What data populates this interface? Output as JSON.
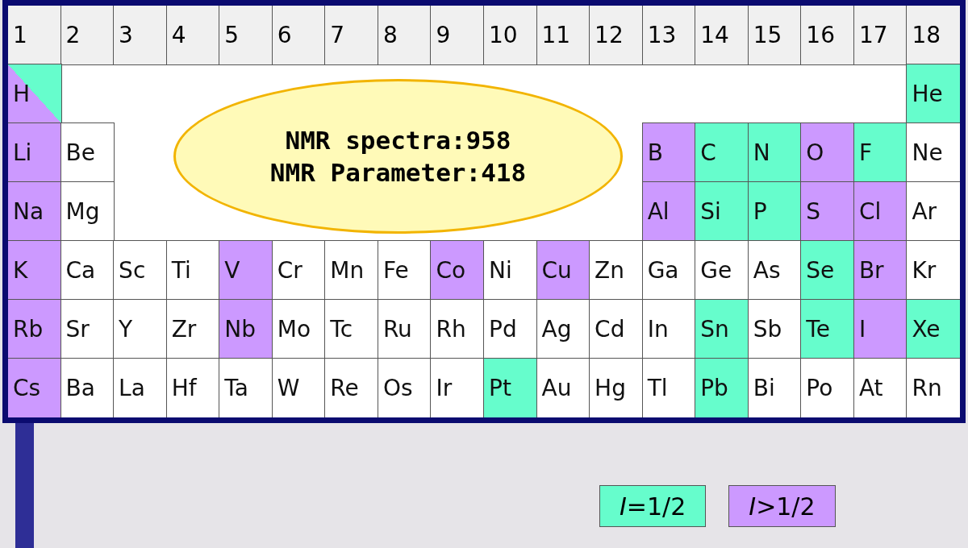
{
  "groups": [
    "1",
    "2",
    "3",
    "4",
    "5",
    "6",
    "7",
    "8",
    "9",
    "10",
    "11",
    "12",
    "13",
    "14",
    "15",
    "16",
    "17",
    "18"
  ],
  "periods": [
    {
      "left": [
        {
          "symbol": "H",
          "kind": "both"
        }
      ],
      "right": [
        {
          "symbol": "He",
          "kind": "half"
        }
      ]
    },
    {
      "left": [
        {
          "symbol": "Li",
          "kind": "gt"
        },
        {
          "symbol": "Be",
          "kind": "none"
        }
      ],
      "right": [
        {
          "symbol": "B",
          "kind": "gt"
        },
        {
          "symbol": "C",
          "kind": "half"
        },
        {
          "symbol": "N",
          "kind": "half"
        },
        {
          "symbol": "O",
          "kind": "gt"
        },
        {
          "symbol": "F",
          "kind": "half"
        },
        {
          "symbol": "Ne",
          "kind": "none"
        }
      ]
    },
    {
      "left": [
        {
          "symbol": "Na",
          "kind": "gt"
        },
        {
          "symbol": "Mg",
          "kind": "none"
        }
      ],
      "right": [
        {
          "symbol": "Al",
          "kind": "gt"
        },
        {
          "symbol": "Si",
          "kind": "half"
        },
        {
          "symbol": "P",
          "kind": "half"
        },
        {
          "symbol": "S",
          "kind": "gt"
        },
        {
          "symbol": "Cl",
          "kind": "gt"
        },
        {
          "symbol": "Ar",
          "kind": "none"
        }
      ]
    },
    {
      "left": [
        {
          "symbol": "K",
          "kind": "gt"
        },
        {
          "symbol": "Ca",
          "kind": "none"
        },
        {
          "symbol": "Sc",
          "kind": "none"
        },
        {
          "symbol": "Ti",
          "kind": "none"
        },
        {
          "symbol": "V",
          "kind": "gt"
        },
        {
          "symbol": "Cr",
          "kind": "none"
        },
        {
          "symbol": "Mn",
          "kind": "none"
        },
        {
          "symbol": "Fe",
          "kind": "none"
        },
        {
          "symbol": "Co",
          "kind": "gt"
        },
        {
          "symbol": "Ni",
          "kind": "none"
        },
        {
          "symbol": "Cu",
          "kind": "gt"
        },
        {
          "symbol": "Zn",
          "kind": "none"
        },
        {
          "symbol": "Ga",
          "kind": "none"
        },
        {
          "symbol": "Ge",
          "kind": "none"
        },
        {
          "symbol": "As",
          "kind": "none"
        },
        {
          "symbol": "Se",
          "kind": "half"
        },
        {
          "symbol": "Br",
          "kind": "gt"
        },
        {
          "symbol": "Kr",
          "kind": "none"
        }
      ]
    },
    {
      "left": [
        {
          "symbol": "Rb",
          "kind": "gt"
        },
        {
          "symbol": "Sr",
          "kind": "none"
        },
        {
          "symbol": "Y",
          "kind": "none"
        },
        {
          "symbol": "Zr",
          "kind": "none"
        },
        {
          "symbol": "Nb",
          "kind": "gt"
        },
        {
          "symbol": "Mo",
          "kind": "none"
        },
        {
          "symbol": "Tc",
          "kind": "none"
        },
        {
          "symbol": "Ru",
          "kind": "none"
        },
        {
          "symbol": "Rh",
          "kind": "none"
        },
        {
          "symbol": "Pd",
          "kind": "none"
        },
        {
          "symbol": "Ag",
          "kind": "none"
        },
        {
          "symbol": "Cd",
          "kind": "none"
        },
        {
          "symbol": "In",
          "kind": "none"
        },
        {
          "symbol": "Sn",
          "kind": "half"
        },
        {
          "symbol": "Sb",
          "kind": "none"
        },
        {
          "symbol": "Te",
          "kind": "half"
        },
        {
          "symbol": "I",
          "kind": "gt"
        },
        {
          "symbol": "Xe",
          "kind": "half"
        }
      ]
    },
    {
      "left": [
        {
          "symbol": "Cs",
          "kind": "gt"
        },
        {
          "symbol": "Ba",
          "kind": "none"
        },
        {
          "symbol": "La",
          "kind": "none"
        },
        {
          "symbol": "Hf",
          "kind": "none"
        },
        {
          "symbol": "Ta",
          "kind": "none"
        },
        {
          "symbol": "W",
          "kind": "none"
        },
        {
          "symbol": "Re",
          "kind": "none"
        },
        {
          "symbol": "Os",
          "kind": "none"
        },
        {
          "symbol": "Ir",
          "kind": "none"
        },
        {
          "symbol": "Pt",
          "kind": "half"
        },
        {
          "symbol": "Au",
          "kind": "none"
        },
        {
          "symbol": "Hg",
          "kind": "none"
        },
        {
          "symbol": "Tl",
          "kind": "none"
        },
        {
          "symbol": "Pb",
          "kind": "half"
        },
        {
          "symbol": "Bi",
          "kind": "none"
        },
        {
          "symbol": "Po",
          "kind": "none"
        },
        {
          "symbol": "At",
          "kind": "none"
        },
        {
          "symbol": "Rn",
          "kind": "none"
        }
      ]
    }
  ],
  "summary": [
    "NMR spectra:958",
    "NMR Parameter:418"
  ],
  "legend": [
    {
      "label": "*I*=1/2",
      "kind": "half"
    },
    {
      "label": "*I*>1/2",
      "kind": "gt"
    }
  ]
}
